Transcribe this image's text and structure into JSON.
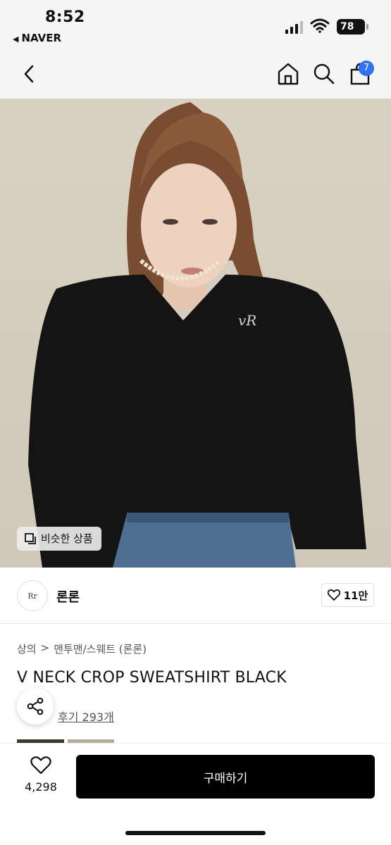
{
  "status": {
    "time": "8:52",
    "back_app": "NAVER",
    "battery": "78"
  },
  "nav": {
    "cart_count": "7"
  },
  "hero": {
    "similar_label": "비슷한 상품",
    "logo_text": "vR"
  },
  "brand": {
    "name": "론론",
    "logo_text": "Rr",
    "likes": "11만"
  },
  "breadcrumb": {
    "items": [
      "상의",
      "맨투맨/스웨트 (론론)"
    ],
    "separator": ">"
  },
  "product": {
    "title": "V NECK CROP SWEATSHIRT BLACK",
    "review_link": "후기 293개"
  },
  "bottom": {
    "wish_count": "4,298",
    "buy_label": "구매하기"
  },
  "colors": {
    "buy": "#000000",
    "badge": "#2f73f3"
  }
}
